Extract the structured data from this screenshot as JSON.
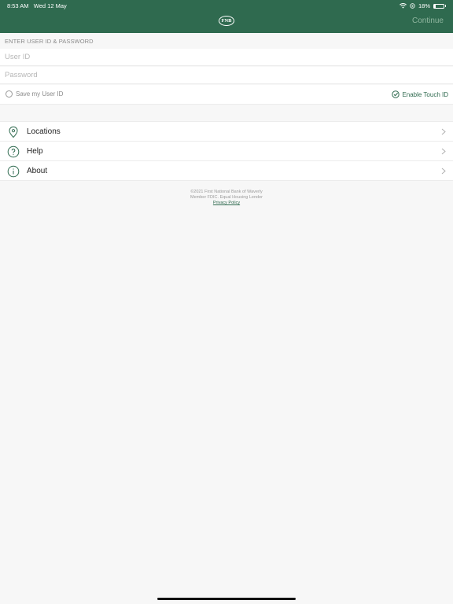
{
  "status_bar": {
    "time": "8:53 AM",
    "date": "Wed 12 May",
    "battery_percent": "18%",
    "battery_level": 0.18
  },
  "header": {
    "logo_text": "FNB",
    "continue_label": "Continue",
    "background_color": "#2f6a4f",
    "continue_color": "#8fb59f"
  },
  "login": {
    "section_title": "ENTER USER ID & PASSWORD",
    "user_id_placeholder": "User ID",
    "user_id_value": "",
    "password_placeholder": "Password",
    "password_value": "",
    "save_user_id_label": "Save my User ID",
    "enable_touch_id_label": "Enable Touch ID",
    "accent_color": "#2f6a4f"
  },
  "menu": {
    "items": [
      {
        "label": "Locations",
        "icon": "location-pin-icon"
      },
      {
        "label": "Help",
        "icon": "question-circle-icon"
      },
      {
        "label": "About",
        "icon": "info-circle-icon"
      }
    ]
  },
  "footer": {
    "copyright": "©2021 First National Bank of Waverly",
    "member": "Member FDIC. Equal Housing Lender",
    "privacy_link": "Privacy Policy"
  }
}
